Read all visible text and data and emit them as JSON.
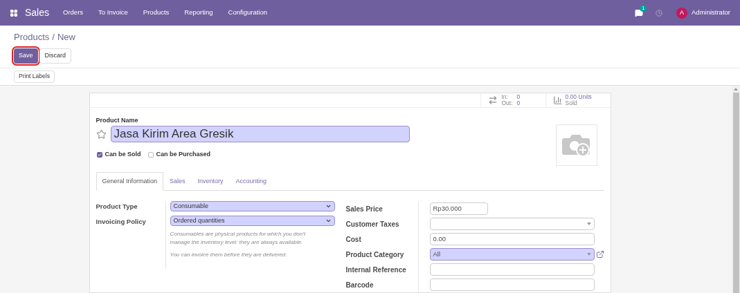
{
  "navbar": {
    "app": "Sales",
    "menu": [
      "Orders",
      "To Invoice",
      "Products",
      "Reporting",
      "Configuration"
    ],
    "messages_count": "1",
    "user_initial": "A",
    "user": "Administrator"
  },
  "breadcrumb": {
    "parent": "Products",
    "separator": "/",
    "current": "New"
  },
  "actions": [
    {
      "label": "Save",
      "primary": true,
      "highlighted": true
    },
    {
      "label": "Discard",
      "primary": false,
      "highlighted": false
    }
  ],
  "toolbar": [
    "Print Labels"
  ],
  "stat_buttons": [
    {
      "kind": "moves",
      "in_label": "In:",
      "in_value": "0",
      "out_label": "Out:",
      "out_value": "0"
    },
    {
      "kind": "sold",
      "value": "0.00 Units",
      "label": "Sold"
    }
  ],
  "product_name_label": "Product Name",
  "product_name": "Jasa Kirim Area Gresik",
  "favorite": false,
  "options": [
    {
      "label": "Can be Sold",
      "checked": true
    },
    {
      "label": "Can be Purchased",
      "checked": false
    }
  ],
  "tabs": [
    {
      "label": "General Information",
      "selected": true
    },
    {
      "label": "Sales",
      "selected": false
    },
    {
      "label": "Inventory",
      "selected": false
    },
    {
      "label": "Accounting",
      "selected": false
    }
  ],
  "left_fields": [
    {
      "label": "Product Type",
      "value": "Consumable"
    },
    {
      "label": "Invoicing Policy",
      "value": "Ordered quantities"
    }
  ],
  "help_texts": [
    "Consumables are physical products for which you don't manage the inventory level: they are always available.",
    "You can invoice them before they are delivered."
  ],
  "right_fields": [
    {
      "kind": "input",
      "label": "Sales Price",
      "value": "Rp30.000",
      "short": true,
      "required": false
    },
    {
      "kind": "many2many",
      "label": "Customer Taxes",
      "short": false,
      "required": false
    },
    {
      "kind": "input",
      "label": "Cost",
      "value": "0.00",
      "short": false,
      "required": false
    },
    {
      "kind": "many2one",
      "label": "Product Category",
      "value": "All",
      "short": false,
      "required": true
    },
    {
      "kind": "input",
      "label": "Internal Reference",
      "short": false,
      "required": false
    },
    {
      "kind": "input",
      "label": "Barcode",
      "short": false,
      "required": false
    }
  ]
}
